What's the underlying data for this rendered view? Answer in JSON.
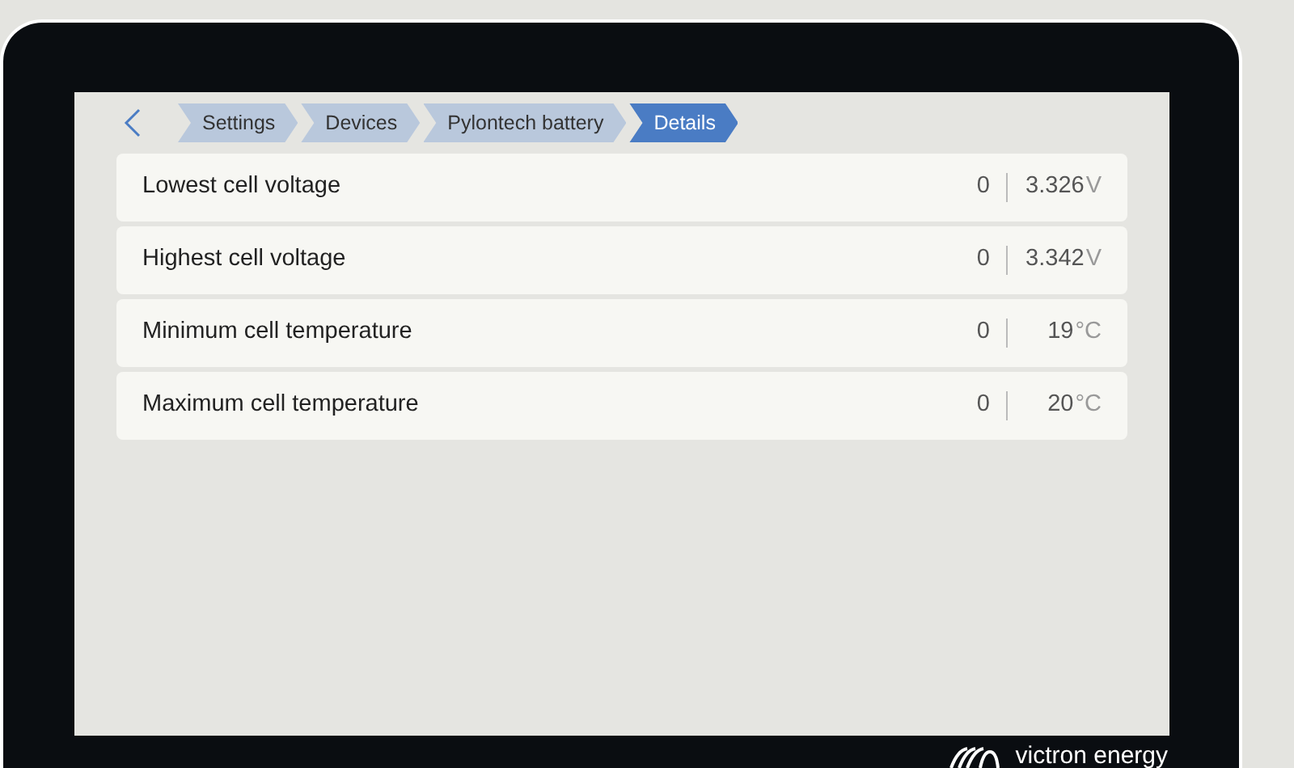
{
  "breadcrumb": [
    {
      "label": "Settings",
      "selected": false
    },
    {
      "label": "Devices",
      "selected": false
    },
    {
      "label": "Pylontech battery",
      "selected": false
    },
    {
      "label": "Details",
      "selected": true
    }
  ],
  "rows": [
    {
      "label": "Lowest cell voltage",
      "count": "0",
      "value": "3.326",
      "unit": "V"
    },
    {
      "label": "Highest cell voltage",
      "count": "0",
      "value": "3.342",
      "unit": "V"
    },
    {
      "label": "Minimum cell temperature",
      "count": "0",
      "value": "19",
      "unit": "°C"
    },
    {
      "label": "Maximum cell temperature",
      "count": "0",
      "value": "20",
      "unit": "°C"
    }
  ],
  "brand": "victron energy"
}
